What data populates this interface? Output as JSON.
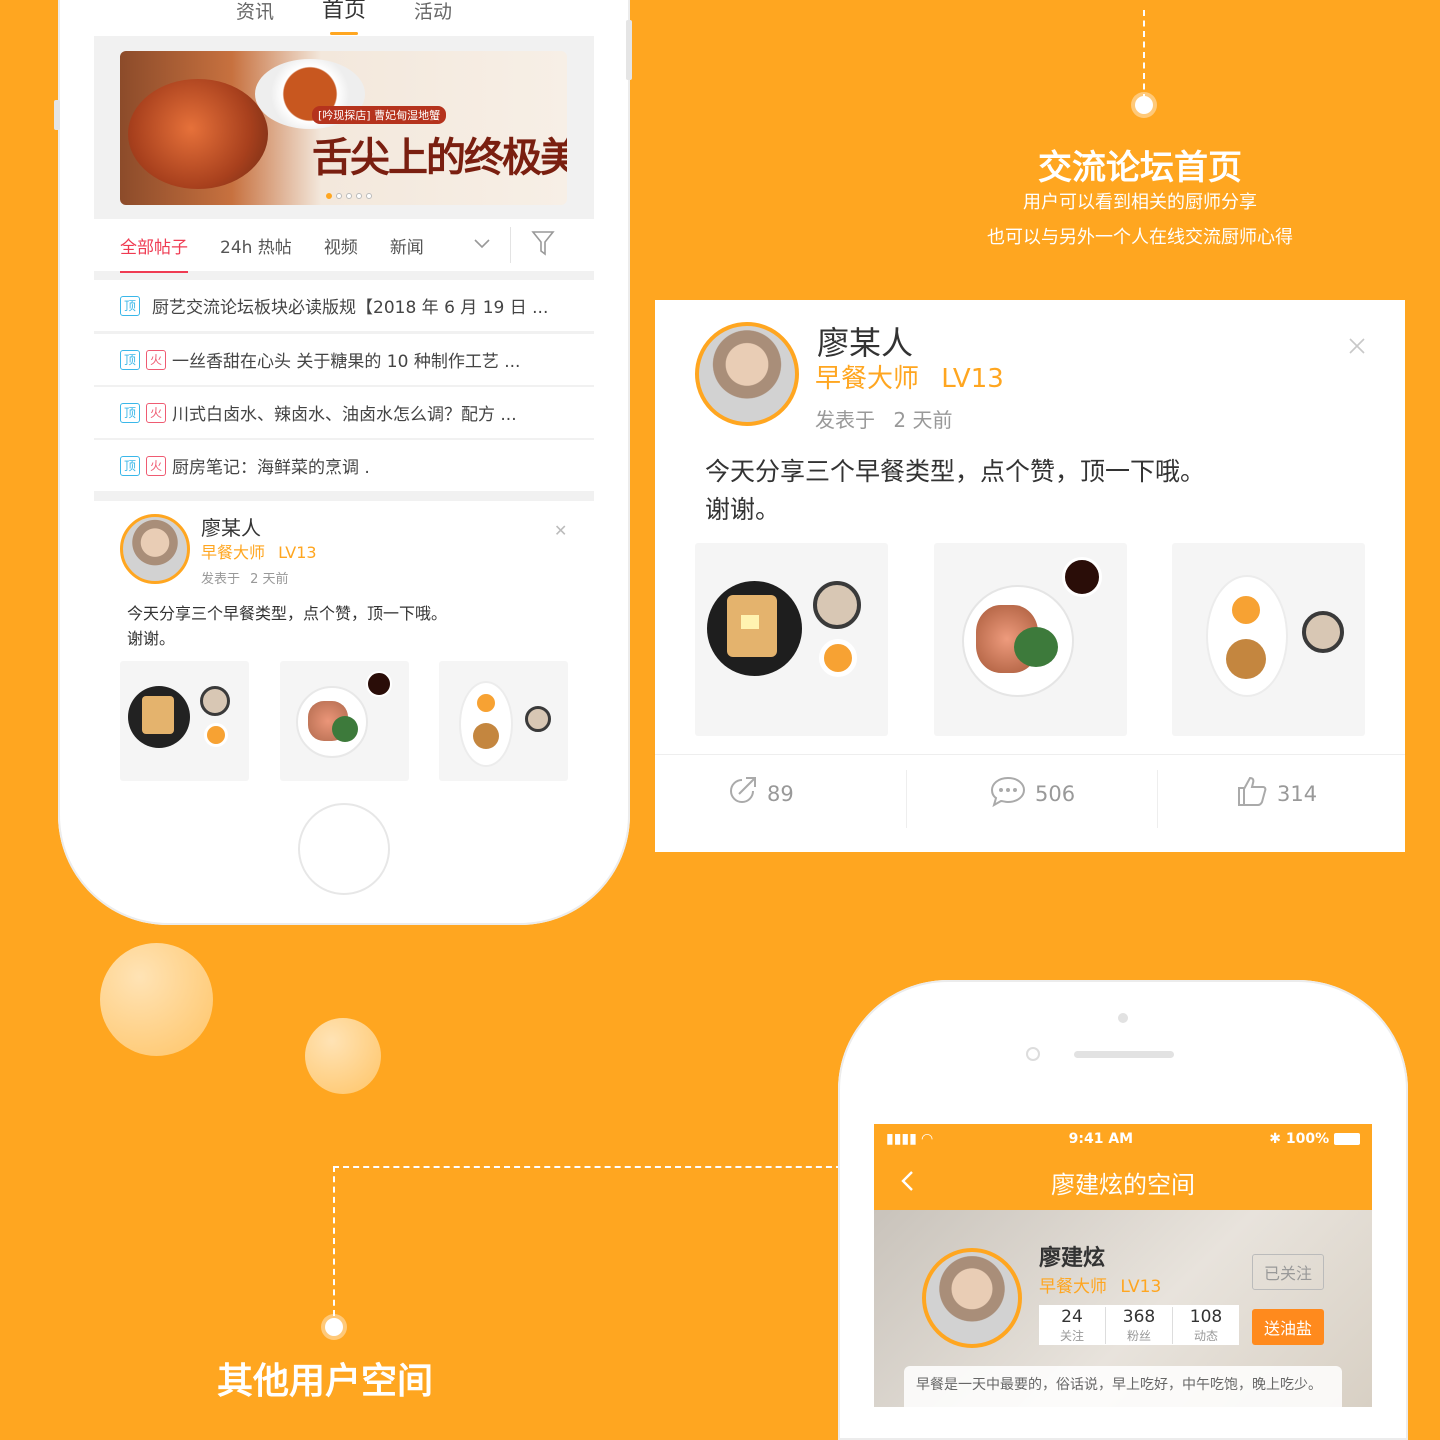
{
  "phone1": {
    "top_tabs": [
      "资讯",
      "首页",
      "活动"
    ],
    "active_tab": "首页",
    "banner": {
      "tag": "[吟现探店] 曹妃甸湿地蟹",
      "headline": "舌尖上的终极美味"
    },
    "filter_tabs": [
      "全部帖子",
      "24h 热帖",
      "视频",
      "新闻"
    ],
    "posts": [
      {
        "badges": [
          "顶"
        ],
        "title": "厨艺交流论坛板块必读版规【2018 年 6 月 19 日 ..."
      },
      {
        "badges": [
          "顶",
          "火"
        ],
        "title": "一丝香甜在心头 关于糖果的 10 种制作工艺 ..."
      },
      {
        "badges": [
          "顶",
          "火"
        ],
        "title": "川式白卤水、辣卤水、油卤水怎么调？配方 ..."
      },
      {
        "badges": [
          "顶",
          "火"
        ],
        "title": "厨房笔记：海鲜菜的烹调 ."
      }
    ],
    "card": {
      "name": "廖某人",
      "rank": "早餐大师",
      "level": "LV13",
      "posted_label": "发表于",
      "time": "2 天前",
      "text1": "今天分享三个早餐类型，点个赞，顶一下哦。",
      "text2": "谢谢。"
    }
  },
  "section1": {
    "title": "交流论坛首页",
    "line1": "用户可以看到相关的厨师分享",
    "line2": "也可以与另外一个人在线交流厨师心得"
  },
  "bigcard": {
    "name": "廖某人",
    "rank": "早餐大师",
    "level": "LV13",
    "posted_label": "发表于",
    "time": "2 天前",
    "text1": "今天分享三个早餐类型，点个赞，顶一下哦。",
    "text2": "谢谢。",
    "share_count": "89",
    "comment_count": "506",
    "like_count": "314"
  },
  "section2": {
    "title": "其他用户空间"
  },
  "phone2": {
    "time": "9:41 AM",
    "battery": "100%",
    "title": "廖建炫的空间",
    "name": "廖建炫",
    "rank": "早餐大师",
    "level": "LV13",
    "follow_btn": "已关注",
    "gift_btn": "送油盐",
    "stats": [
      {
        "num": "24",
        "label": "关注"
      },
      {
        "num": "368",
        "label": "粉丝"
      },
      {
        "num": "108",
        "label": "动态"
      }
    ],
    "bio": "早餐是一天中最要的，俗话说，早上吃好，中午吃饱，晚上吃少。"
  },
  "colors": {
    "accent": "#FFA620",
    "hot": "#ef3b52",
    "top_badge": "#3ab7e9"
  },
  "icons": [
    "share-icon",
    "comment-icon",
    "like-icon",
    "close-icon",
    "filter-icon",
    "chevron-down-icon",
    "back-icon"
  ]
}
